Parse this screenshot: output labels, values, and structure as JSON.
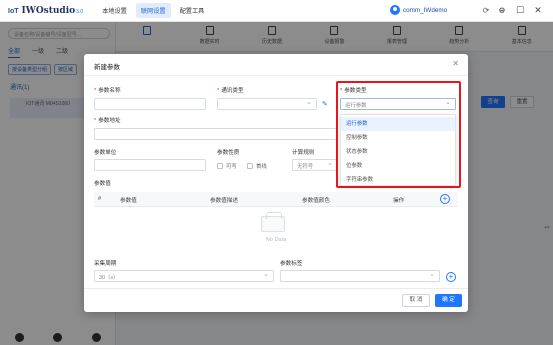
{
  "app": {
    "logo_prefix": "IoT",
    "logo_name": "IWOstudio",
    "logo_version": "3.0",
    "menu": [
      "本地设置",
      "联网设置",
      "配置工具"
    ],
    "menu_active_index": 1,
    "user_name": "comm_IWdemo",
    "accent_color": "#1f77ff"
  },
  "background": {
    "search_placeholder": "设备名称/设备编号/设备型号...",
    "tabs": [
      "全部",
      "一级",
      "二级"
    ],
    "filters": [
      "按设备类型分组",
      "按区域"
    ],
    "tree_title": "通讯(1)",
    "tree_item": "IOT通讯 M04S1060",
    "toolbar": [
      "",
      "数据实时",
      "历史数据",
      "设备报警",
      "报表管理",
      "趋势分析",
      "基本信息"
    ],
    "query_label": "查询",
    "reset_label": "重置"
  },
  "modal": {
    "title": "新建参数",
    "close_icon": "close-icon",
    "fields": {
      "param_name": {
        "label": "参数名称",
        "required": true,
        "value": ""
      },
      "comm_type": {
        "label": "通讯类型",
        "required": true,
        "value": ""
      },
      "param_type": {
        "label": "参数类型",
        "required": true,
        "value": "运行参数"
      },
      "param_address": {
        "label": "参数地址",
        "required": true,
        "value": ""
      },
      "param_unit": {
        "label": "参数单位",
        "required": false,
        "value": ""
      },
      "param_nature": {
        "label": "参数性质",
        "required": false,
        "options": [
          "可写",
          "首线"
        ]
      },
      "calc_rule": {
        "label": "计算规则",
        "required": false,
        "value": "无符号"
      },
      "sample_period": {
        "label": "采集周期",
        "required": false,
        "value": "30（s）"
      },
      "param_tag": {
        "label": "参数标签",
        "required": false,
        "value": ""
      }
    },
    "param_type_options": [
      "运行参数",
      "控制参数",
      "状态参数",
      "位参数",
      "字符串参数"
    ],
    "param_type_selected_index": 0,
    "param_values_label": "参数值",
    "table": {
      "headers": [
        "#",
        "参数值",
        "参数值描述",
        "参数值颜色",
        "操作"
      ],
      "rows": [],
      "empty_text": "No Data"
    },
    "cancel_label": "取 消",
    "ok_label": "确 定"
  }
}
